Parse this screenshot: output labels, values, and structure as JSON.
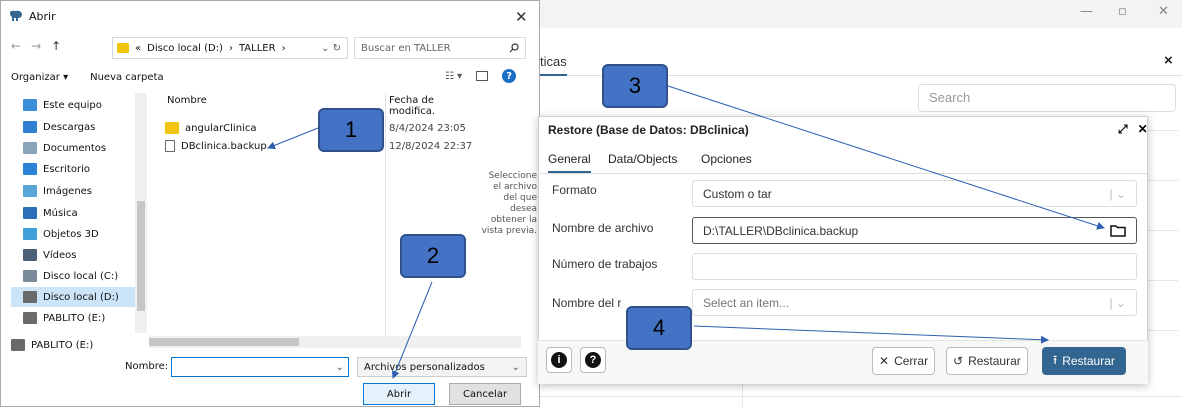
{
  "background": {
    "tab_label": "ticas",
    "close_symbol": "×",
    "search_placeholder": "Search",
    "win_minimize": "—",
    "win_restore": "▫",
    "win_close": "✕"
  },
  "file_dialog": {
    "title": "Abrir",
    "close_symbol": "✕",
    "nav_back": "←",
    "nav_fwd": "→",
    "nav_up": "↑",
    "address": [
      "«",
      "Disco local (D:)",
      "›",
      "TALLER",
      "›"
    ],
    "search_placeholder": "Buscar en TALLER",
    "organize_label": "Organizar ▾",
    "new_folder_label": "Nueva carpeta",
    "sidebar": [
      {
        "label": "Este equipo",
        "color": "#3b8ed8",
        "selected": false
      },
      {
        "label": "Descargas",
        "color": "#2f7fd0",
        "selected": false
      },
      {
        "label": "Documentos",
        "color": "#8aa3b8",
        "selected": false
      },
      {
        "label": "Escritorio",
        "color": "#2b83d6",
        "selected": false
      },
      {
        "label": "Imágenes",
        "color": "#5aa6d8",
        "selected": false
      },
      {
        "label": "Música",
        "color": "#2a6fb8",
        "selected": false
      },
      {
        "label": "Objetos 3D",
        "color": "#3fa0d8",
        "selected": false
      },
      {
        "label": "Vídeos",
        "color": "#4c6177",
        "selected": false
      },
      {
        "label": "Disco local (C:)",
        "color": "#7a8a99",
        "selected": false
      },
      {
        "label": "Disco local (D:)",
        "color": "#6a6a6a",
        "selected": true
      },
      {
        "label": "PABLITO (E:)",
        "color": "#6a6a6a",
        "selected": false
      },
      {
        "label": "PABLITO (E:)",
        "color": "#6a6a6a",
        "selected": false
      }
    ],
    "col_name": "Nombre",
    "col_date": "Fecha de modifica.",
    "files": [
      {
        "name": "angularClinica",
        "date": "8/4/2024 23:05",
        "kind": "folder"
      },
      {
        "name": "DBclinica.backup",
        "date": "12/8/2024 22:37",
        "kind": "file"
      }
    ],
    "preview_text": "Seleccione el archivo del que desea obtener la vista previa.",
    "name_label": "Nombre:",
    "name_value": "",
    "file_type": "Archivos personalizados",
    "open_label": "Abrir",
    "cancel_label": "Cancelar"
  },
  "restore_dialog": {
    "title": "Restore (Base de Datos: DBclinica)",
    "expand_symbol": "⤢",
    "close_symbol": "✕",
    "tabs": [
      "General",
      "Data/Objects",
      "Opciones"
    ],
    "fields": {
      "format_label": "Formato",
      "format_value": "Custom o tar",
      "filename_label": "Nombre de archivo",
      "filename_value": "D:\\TALLER\\DBclinica.backup",
      "jobs_label": "Número de trabajos",
      "jobs_value": "",
      "role_label": "Nombre del r",
      "role_placeholder": "Select an item..."
    },
    "info_symbol": "i",
    "help_symbol": "?",
    "close_btn": "Cerrar",
    "reset_btn": "Restaurar",
    "restore_btn": "Restaurar"
  },
  "callouts": [
    "1",
    "2",
    "3",
    "4"
  ],
  "colors": {
    "accent": "#326690",
    "callout": "#4472c4",
    "arrow": "#2f5fb0"
  }
}
